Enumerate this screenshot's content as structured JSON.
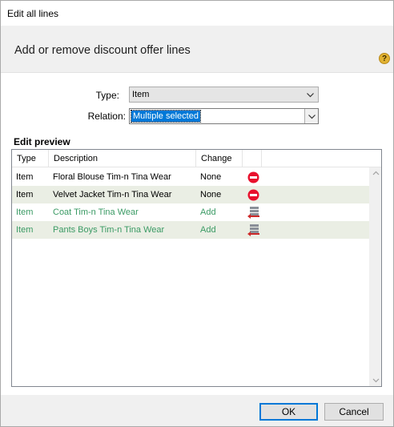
{
  "window": {
    "title": "Edit all lines"
  },
  "header": {
    "heading": "Add or remove discount offer lines",
    "help_glyph": "?"
  },
  "form": {
    "type_label": "Type:",
    "type_value": "Item",
    "relation_label": "Relation:",
    "relation_value": "Multiple selected"
  },
  "preview": {
    "label": "Edit preview",
    "columns": [
      "Type",
      "Description",
      "Change",
      ""
    ],
    "rows": [
      {
        "type": "Item",
        "description": "Floral Blouse Tim-n Tina Wear",
        "change": "None",
        "icon": "remove-icon"
      },
      {
        "type": "Item",
        "description": "Velvet Jacket Tim-n Tina Wear",
        "change": "None",
        "icon": "remove-icon"
      },
      {
        "type": "Item",
        "description": "Coat Tim-n Tina Wear",
        "change": "Add",
        "icon": "add-lines-icon"
      },
      {
        "type": "Item",
        "description": "Pants Boys Tim-n Tina Wear",
        "change": "Add",
        "icon": "add-lines-icon"
      }
    ]
  },
  "footer": {
    "ok_label": "OK",
    "cancel_label": "Cancel"
  },
  "colors": {
    "add_text": "#3a9a64",
    "remove_icon": "#e8112d",
    "accent": "#0078d7",
    "alt_row": "#eaeee4"
  }
}
